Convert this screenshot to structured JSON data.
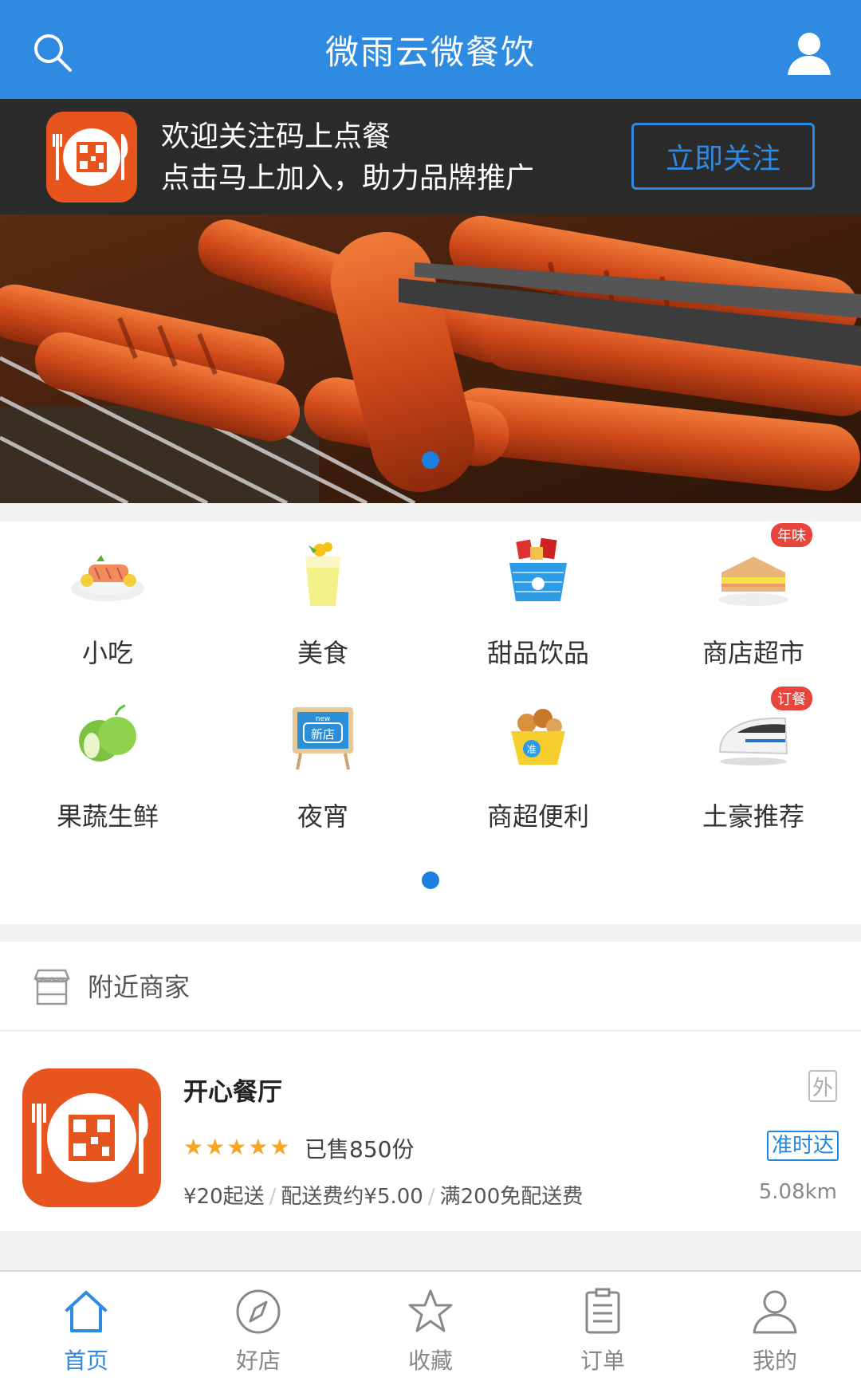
{
  "header": {
    "title": "微雨云微餐饮"
  },
  "follow_banner": {
    "line1": "欢迎关注码上点餐",
    "line2": "点击马上加入，助力品牌推广",
    "button": "立即关注"
  },
  "categories": [
    {
      "label": "小吃",
      "icon": "grilled-fish-icon"
    },
    {
      "label": "美食",
      "icon": "drink-cup-icon"
    },
    {
      "label": "甜品饮品",
      "icon": "basket-icon"
    },
    {
      "label": "商店超市",
      "icon": "sandwich-icon",
      "badge": "年味"
    },
    {
      "label": "果蔬生鲜",
      "icon": "apple-icon"
    },
    {
      "label": "夜宵",
      "icon": "new-store-board-icon",
      "board_text": "新店",
      "board_sub": "new"
    },
    {
      "label": "商超便利",
      "icon": "snack-box-icon",
      "box_text": "准"
    },
    {
      "label": "土豪推荐",
      "icon": "bullet-train-icon",
      "badge": "订餐"
    }
  ],
  "nearby": {
    "label": "附近商家"
  },
  "shop": {
    "name": "开心餐厅",
    "tag": "外",
    "stars": "★★★★★",
    "sold": "已售850份",
    "ontime": "准时达",
    "min_order": "¥20起送",
    "delivery_fee": "配送费约¥5.00",
    "free_delivery": "满200免配送费",
    "distance": "5.08km"
  },
  "tabs": [
    {
      "label": "首页",
      "active": true
    },
    {
      "label": "好店"
    },
    {
      "label": "收藏"
    },
    {
      "label": "订单"
    },
    {
      "label": "我的"
    }
  ],
  "colors": {
    "primary": "#2f8ae2",
    "brand_orange": "#e8541e",
    "star": "#f5a623"
  }
}
